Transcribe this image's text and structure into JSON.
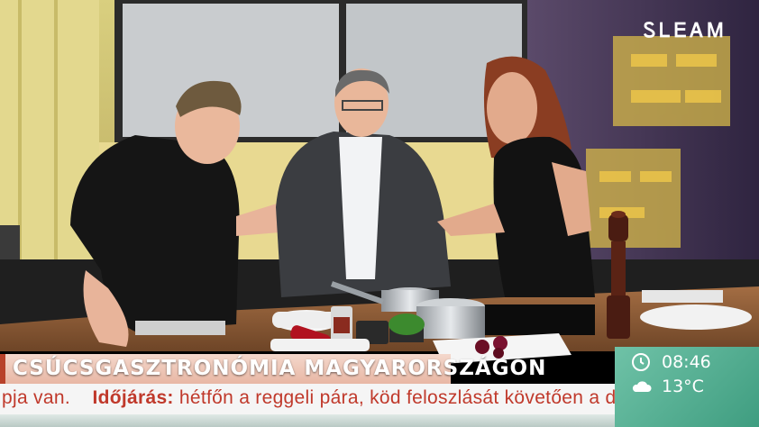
{
  "channel": {
    "logo_text": "ᏚᏞᎬᎪᎷ",
    "logo_name": "tv-channel-logo"
  },
  "lower_third": {
    "title": "CSÚCSGASZTRONÓMIA MAGYARORSZÁGON"
  },
  "ticker": {
    "prefix": "pja van.",
    "label": "Időjárás:",
    "text": "hétfőn a reggeli pára, köd feloszlását követően a déli,"
  },
  "info": {
    "time": "08:46",
    "temperature": "13°C",
    "time_icon": "clock-icon",
    "weather_icon": "cloud-icon"
  },
  "colors": {
    "title_band": "#e8b7a4",
    "title_accent": "#b8422a",
    "ticker_bg": "#f5f5f5",
    "ticker_text": "#c0392b",
    "info_panel": "#4fae90"
  }
}
